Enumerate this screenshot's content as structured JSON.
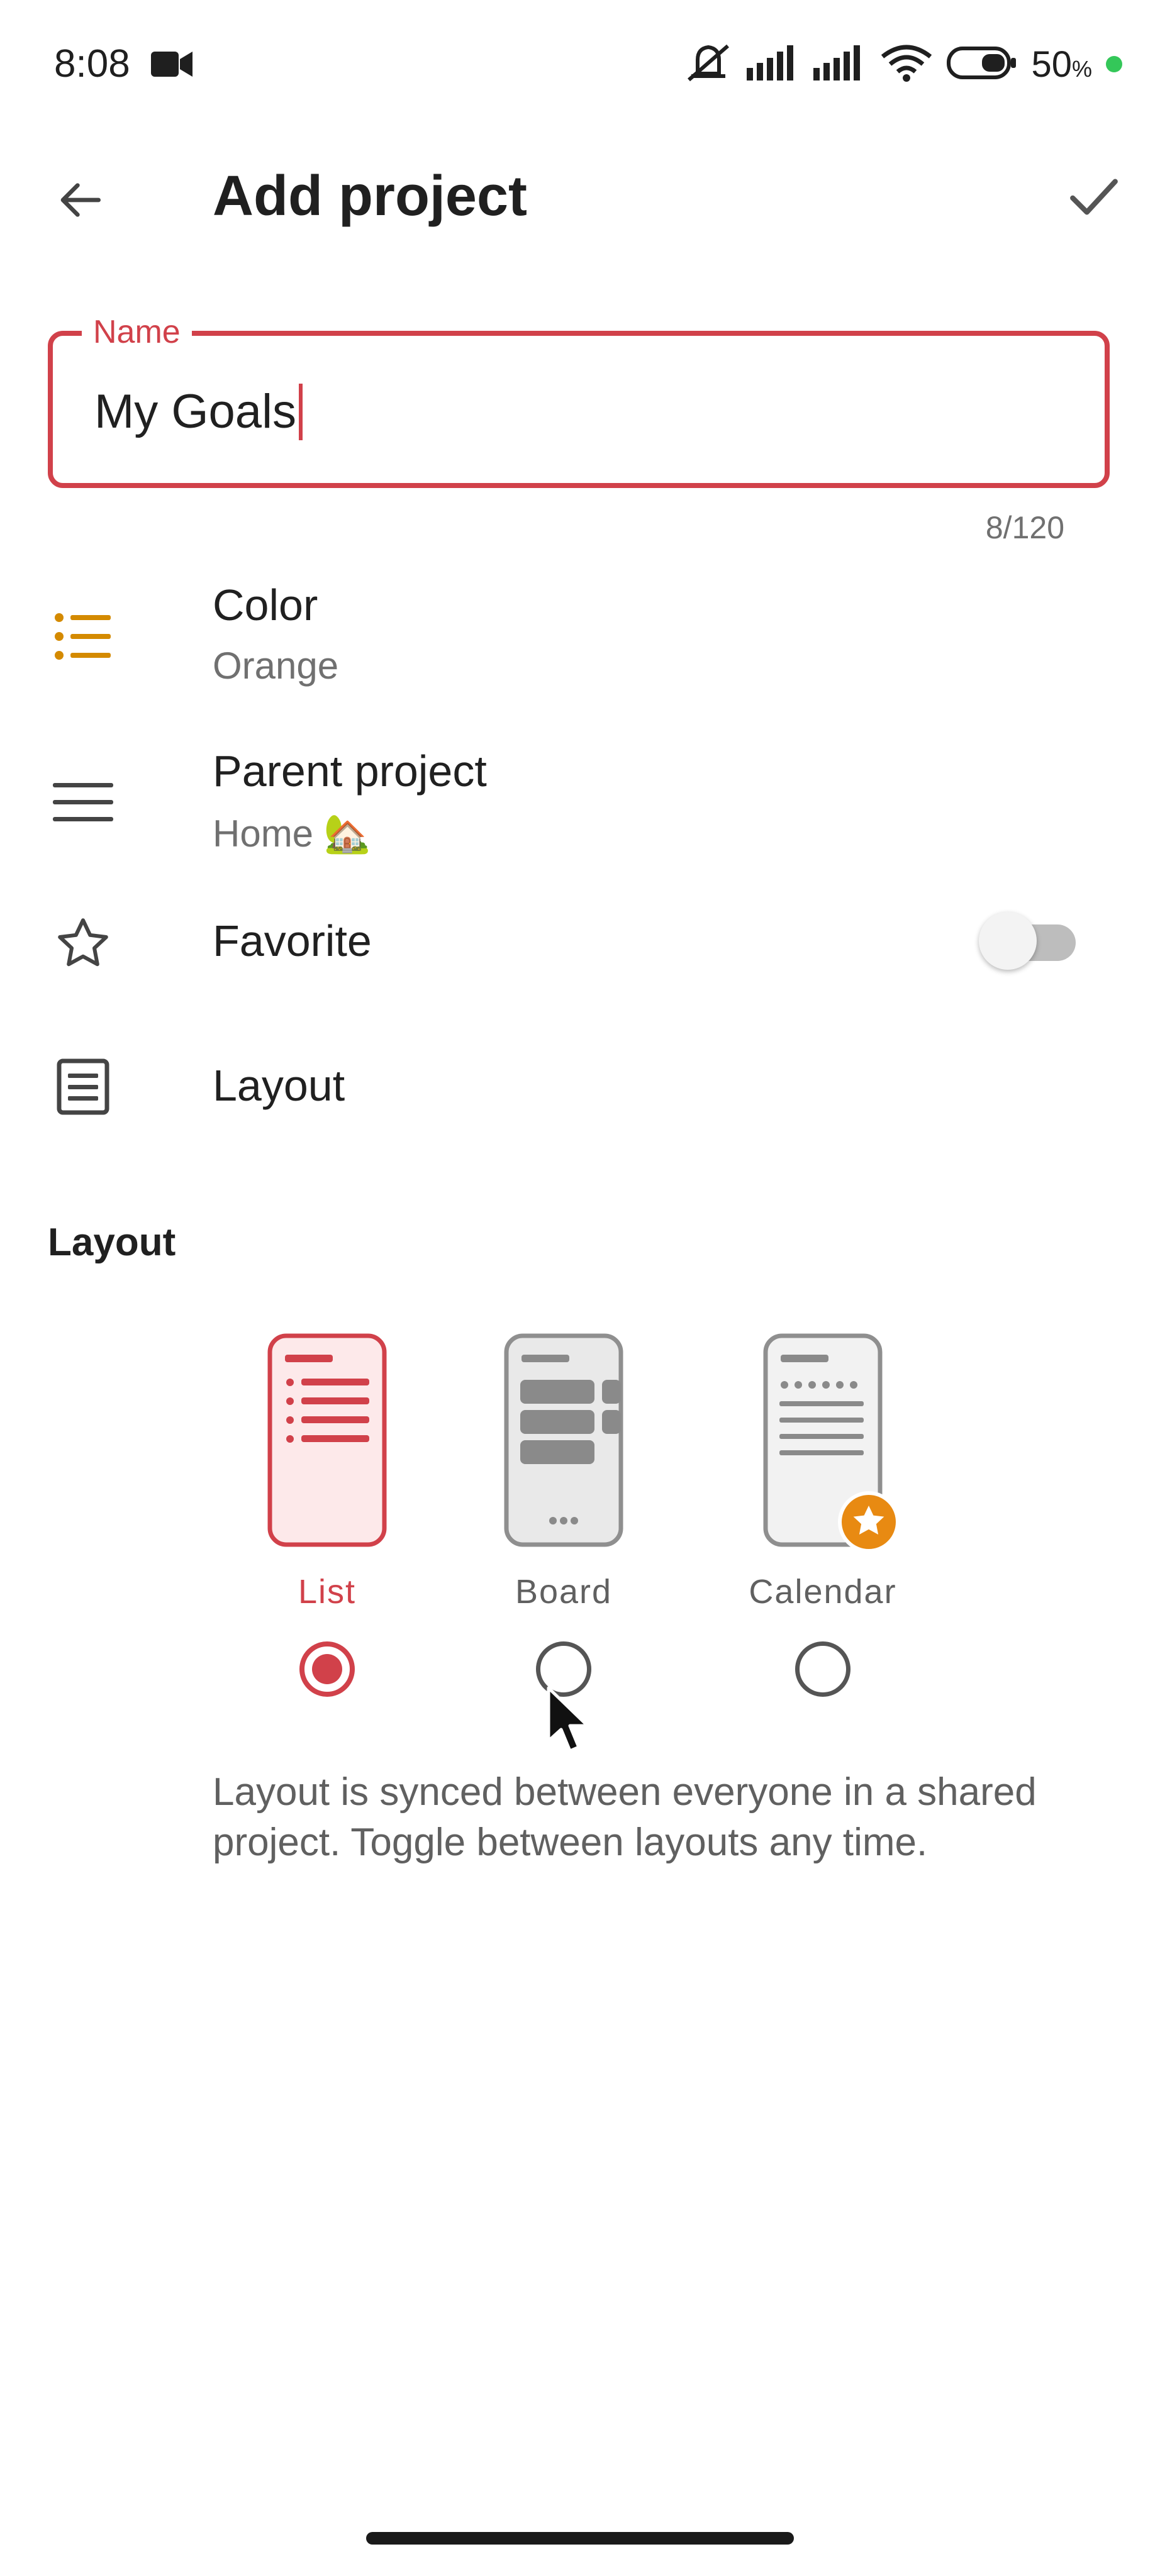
{
  "status_bar": {
    "time": "8:08",
    "battery_percent": "50",
    "battery_suffix": "%",
    "icons": [
      "video-camera-icon",
      "mute-icon",
      "signal-icon",
      "signal-icon",
      "wifi-icon",
      "battery-icon"
    ],
    "dot_color": "#34c759"
  },
  "app_bar": {
    "title": "Add project"
  },
  "name_field": {
    "label": "Name",
    "value": "My Goals",
    "counter": "8/120"
  },
  "settings": {
    "color": {
      "title": "Color",
      "value": "Orange",
      "icon_color": "#d48a00"
    },
    "parent": {
      "title": "Parent project",
      "value": "Home 🏡"
    },
    "favorite": {
      "title": "Favorite",
      "enabled": false
    },
    "layout": {
      "title": "Layout"
    }
  },
  "layout_section": {
    "header": "Layout",
    "options": [
      {
        "label": "List",
        "selected": true
      },
      {
        "label": "Board",
        "selected": false
      },
      {
        "label": "Calendar",
        "selected": false
      }
    ],
    "note": "Layout is synced between everyone in a shared project. Toggle between layouts any time."
  },
  "colors": {
    "accent": "#d1414a",
    "muted": "#707070",
    "star_badge": "#e88a12"
  }
}
